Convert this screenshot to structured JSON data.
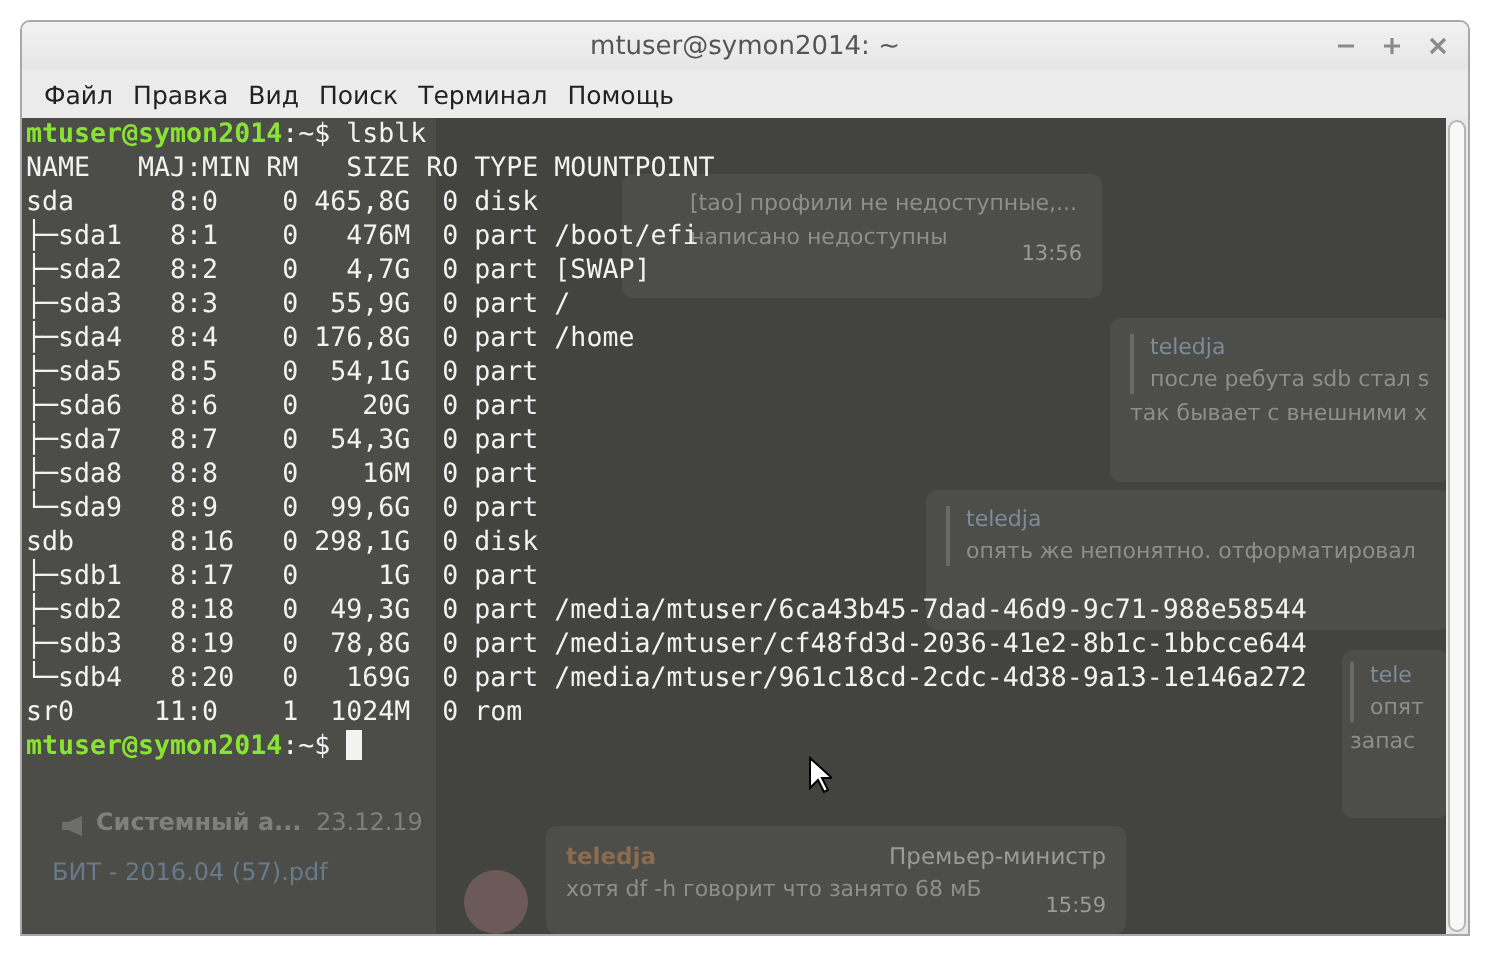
{
  "window": {
    "title": "mtuser@symon2014: ~"
  },
  "menu": [
    "Файл",
    "Правка",
    "Вид",
    "Поиск",
    "Терминал",
    "Помощь"
  ],
  "terminal": {
    "lines": [
      {
        "kind": "prompt",
        "user_host": "mtuser@symon2014",
        "rest": ":~$ lsblk"
      },
      {
        "kind": "output",
        "text": "NAME   MAJ:MIN RM   SIZE RO TYPE MOUNTPOINT"
      },
      {
        "kind": "output",
        "text": "sda      8:0    0 465,8G  0 disk"
      },
      {
        "kind": "output",
        "text": "├─sda1   8:1    0   476M  0 part /boot/efi"
      },
      {
        "kind": "output",
        "text": "├─sda2   8:2    0   4,7G  0 part [SWAP]"
      },
      {
        "kind": "output",
        "text": "├─sda3   8:3    0  55,9G  0 part /"
      },
      {
        "kind": "output",
        "text": "├─sda4   8:4    0 176,8G  0 part /home"
      },
      {
        "kind": "output",
        "text": "├─sda5   8:5    0  54,1G  0 part"
      },
      {
        "kind": "output",
        "text": "├─sda6   8:6    0    20G  0 part"
      },
      {
        "kind": "output",
        "text": "├─sda7   8:7    0  54,3G  0 part"
      },
      {
        "kind": "output",
        "text": "├─sda8   8:8    0    16M  0 part"
      },
      {
        "kind": "output",
        "text": "└─sda9   8:9    0  99,6G  0 part"
      },
      {
        "kind": "output",
        "text": "sdb      8:16   0 298,1G  0 disk"
      },
      {
        "kind": "output",
        "text": "├─sdb1   8:17   0     1G  0 part"
      },
      {
        "kind": "output",
        "text": "├─sdb2   8:18   0  49,3G  0 part /media/mtuser/6ca43b45-7dad-46d9-9c71-988e58544"
      },
      {
        "kind": "output",
        "text": "├─sdb3   8:19   0  78,8G  0 part /media/mtuser/cf48fd3d-2036-41e2-8b1c-1bbcce644"
      },
      {
        "kind": "output",
        "text": "└─sdb4   8:20   0   169G  0 part /media/mtuser/961c18cd-2cdc-4d38-9a13-1e146a272"
      },
      {
        "kind": "output",
        "text": "sr0     11:0    1  1024M  0 rom"
      },
      {
        "kind": "prompt",
        "user_host": "mtuser@symon2014",
        "rest": ":~$ ",
        "cursor": true
      }
    ]
  },
  "background_chat": {
    "sidebar": {
      "chat_name": "Системный а...",
      "date": "23.12.19",
      "preview": "БИТ - 2016.04 (57).pdf"
    },
    "messages": [
      {
        "lines": [
          "[tao] профили не недоступные,...",
          "написано недоступны"
        ],
        "time": "13:56"
      },
      {
        "quote_author": "teledja",
        "quote": "после ребута sdb стал s",
        "lines": [
          "так бывает с внешними х"
        ]
      },
      {
        "quote_author": "teledja",
        "quote": "опять же непонятно. отформатировал"
      },
      {
        "quote_author": "tele",
        "quote": "опят",
        "lines": [
          "запас"
        ]
      },
      {
        "sender": "teledja",
        "role": "Премьер-министр",
        "lines": [
          "хотя df -h говорит что занято 68 мБ"
        ],
        "time": "15:59",
        "avatar": true
      }
    ]
  }
}
